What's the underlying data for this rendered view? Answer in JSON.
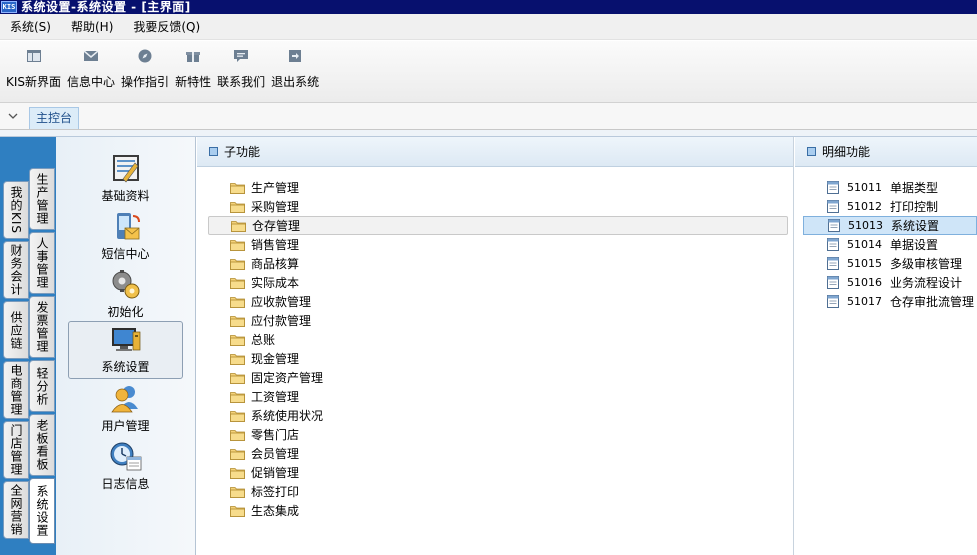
{
  "window": {
    "app_badge": "KIS",
    "title": "系统设置-系统设置 - [主界面]"
  },
  "menu": [
    {
      "label": "系统(S)"
    },
    {
      "label": "帮助(H)"
    },
    {
      "label": "我要反馈(Q)"
    }
  ],
  "toolbar": [
    {
      "label": "KIS新界面",
      "icon": "layout-icon"
    },
    {
      "label": "信息中心",
      "icon": "mail-icon"
    },
    {
      "label": "操作指引",
      "icon": "compass-icon"
    },
    {
      "label": "新特性",
      "icon": "gift-icon"
    },
    {
      "label": "联系我们",
      "icon": "chat-icon"
    },
    {
      "label": "退出系统",
      "icon": "exit-icon"
    }
  ],
  "tabs": {
    "main_tab": "主控台"
  },
  "left_tabs_outer": [
    {
      "label": "我的KIS"
    },
    {
      "label": "财务会计"
    },
    {
      "label": "供应链"
    },
    {
      "label": "电商管理"
    },
    {
      "label": "门店管理"
    },
    {
      "label": "全网营销"
    }
  ],
  "left_tabs_inner": [
    {
      "label": "生产管理"
    },
    {
      "label": "人事管理"
    },
    {
      "label": "发票管理"
    },
    {
      "label": "轻分析"
    },
    {
      "label": "老板看板"
    },
    {
      "label": "系统设置",
      "active": true
    }
  ],
  "modules": [
    {
      "label": "基础资料",
      "icon": "basic-data-icon"
    },
    {
      "label": "短信中心",
      "icon": "sms-center-icon"
    },
    {
      "label": "初始化",
      "icon": "initialize-icon"
    },
    {
      "label": "系统设置",
      "icon": "system-settings-icon",
      "selected": true
    },
    {
      "label": "用户管理",
      "icon": "user-management-icon"
    },
    {
      "label": "日志信息",
      "icon": "log-info-icon"
    }
  ],
  "sub_panel": {
    "header": "子功能",
    "items": [
      {
        "label": "生产管理"
      },
      {
        "label": "采购管理"
      },
      {
        "label": "仓存管理",
        "selected": true
      },
      {
        "label": "销售管理"
      },
      {
        "label": "商品核算"
      },
      {
        "label": "实际成本"
      },
      {
        "label": "应收款管理"
      },
      {
        "label": "应付款管理"
      },
      {
        "label": "总账"
      },
      {
        "label": "现金管理"
      },
      {
        "label": "固定资产管理"
      },
      {
        "label": "工资管理"
      },
      {
        "label": "系统使用状况"
      },
      {
        "label": "零售门店"
      },
      {
        "label": "会员管理"
      },
      {
        "label": "促销管理"
      },
      {
        "label": "标签打印"
      },
      {
        "label": "生态集成"
      }
    ]
  },
  "detail_panel": {
    "header": "明细功能",
    "items": [
      {
        "code": "51011",
        "label": "单据类型"
      },
      {
        "code": "51012",
        "label": "打印控制"
      },
      {
        "code": "51013",
        "label": "系统设置",
        "selected": true
      },
      {
        "code": "51014",
        "label": "单据设置"
      },
      {
        "code": "51015",
        "label": "多级审核管理"
      },
      {
        "code": "51016",
        "label": "业务流程设计"
      },
      {
        "code": "51017",
        "label": "仓存审批流管理"
      }
    ]
  },
  "colors": {
    "title_bar": "#07106e",
    "accent": "#2f7fc1",
    "selection": "#cfe5f8"
  }
}
